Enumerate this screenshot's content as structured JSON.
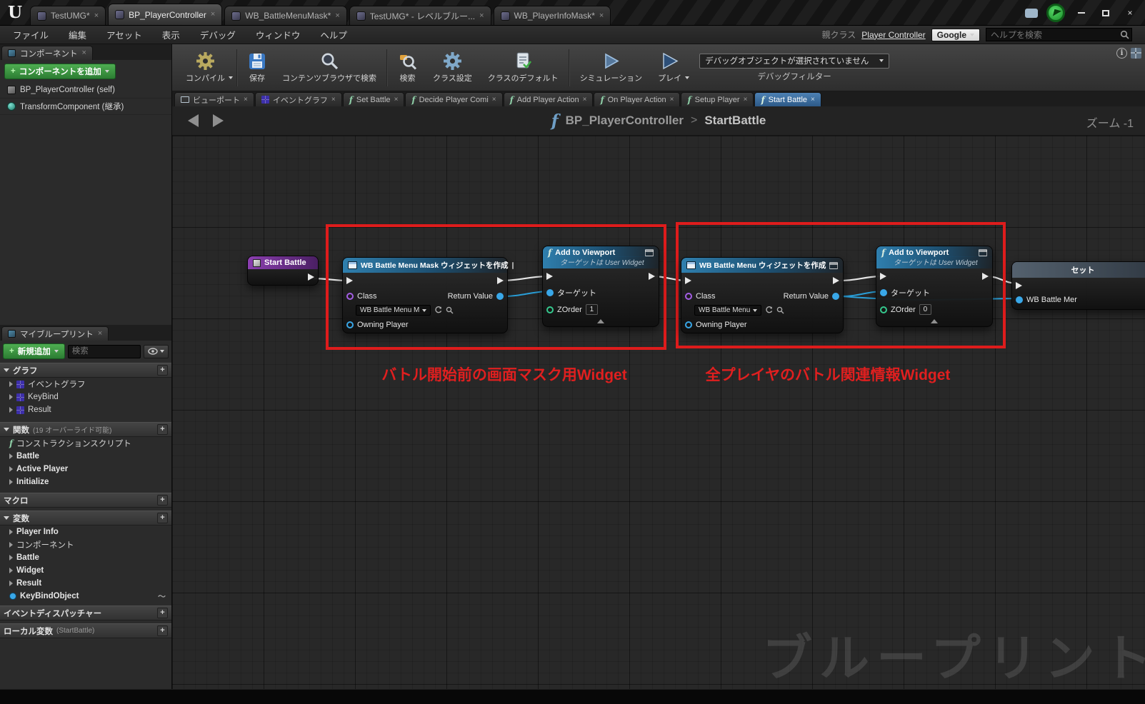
{
  "glyphs": {
    "f": "f",
    "close": "×",
    "gt": ">",
    "plus": "+"
  },
  "colors": {
    "annotation_red": "#de1c1c",
    "node_header_blue": "#2f7fae",
    "event_node_purple": "#8b3fb0",
    "accent_green": "#3fae46",
    "wire_blue": "#2a9fd8",
    "active_tab_blue": "#2d5a88"
  },
  "titlebar": {
    "tabs": [
      {
        "label": "TestUMG*"
      },
      {
        "label": "BP_PlayerController"
      },
      {
        "label": "WB_BattleMenuMask*"
      },
      {
        "label": "TestUMG* - レベルブルー..."
      },
      {
        "label": "WB_PlayerInfoMask*"
      }
    ]
  },
  "menubar": {
    "items": [
      "ファイル",
      "編集",
      "アセット",
      "表示",
      "デバッグ",
      "ウィンドウ",
      "ヘルプ"
    ],
    "parent_class_label": "親クラス",
    "parent_class_value": "Player Controller",
    "google_label": "Google",
    "help_search_placeholder": "ヘルプを検索"
  },
  "components_panel": {
    "tab_title": "コンポーネント",
    "add_component_button": "コンポーネントを追加",
    "tree": [
      {
        "label": "BP_PlayerController (self)"
      },
      {
        "label": "TransformComponent (継承)"
      }
    ]
  },
  "my_blueprint": {
    "tab_title": "マイブループリント",
    "add_new_button": "新規追加",
    "search_placeholder": "検索",
    "sections": {
      "graphs": {
        "title": "グラフ",
        "items": [
          "イベントグラフ",
          "KeyBind",
          "Result"
        ]
      },
      "functions": {
        "title": "関数",
        "subtitle": "(19 オーバーライド可能)",
        "items": [
          "コンストラクションスクリプト",
          "Battle",
          "Active Player",
          "Initialize"
        ]
      },
      "macros": {
        "title": "マクロ"
      },
      "variables": {
        "title": "変数",
        "items": [
          "Player Info",
          "コンポーネント",
          "Battle",
          "Widget",
          "Result",
          "KeyBindObject"
        ]
      },
      "dispatchers": {
        "title": "イベントディスパッチャー"
      },
      "locals": {
        "title": "ローカル変数",
        "subtitle": "(StartBattle)"
      }
    }
  },
  "toolbar": {
    "compile": "コンパイル",
    "save": "保存",
    "find_in_cb": "コンテンツブラウザで検索",
    "search": "検索",
    "class_settings": "クラス設定",
    "class_defaults": "クラスのデフォルト",
    "simulate": "シミュレーション",
    "play": "プレイ",
    "debug_object_dropdown": "デバッグオブジェクトが選択されていません",
    "debug_filter": "デバッグフィルター"
  },
  "graph_tabs": [
    {
      "label": "ビューポート"
    },
    {
      "label": "イベントグラフ"
    },
    {
      "label": "Set Battle"
    },
    {
      "label": "Decide Player Comi"
    },
    {
      "label": "Add Player Action"
    },
    {
      "label": "On Player Action"
    },
    {
      "label": "Setup Player"
    },
    {
      "label": "Start Battle"
    }
  ],
  "breadcrumb": {
    "owner": "BP_PlayerController",
    "current": "StartBattle",
    "zoom": "ズーム -1"
  },
  "graph": {
    "nodes": {
      "start_battle": {
        "title": "Start Battle"
      },
      "create_mask": {
        "title": "WB Battle Menu Mask ウィジェットを作成",
        "class_label": "Class",
        "class_value": "WB Battle Menu M",
        "owning_player_label": "Owning Player",
        "return_label": "Return Value"
      },
      "add_viewport_1": {
        "title": "Add to Viewport",
        "subtitle": "ターゲットは User Widget",
        "target_label": "ターゲット",
        "zorder_label": "ZOrder",
        "zorder_value": "1"
      },
      "create_menu": {
        "title": "WB Battle Menu ウィジェットを作成",
        "class_label": "Class",
        "class_value": "WB Battle Menu",
        "owning_player_label": "Owning Player",
        "return_label": "Return Value"
      },
      "add_viewport_2": {
        "title": "Add to Viewport",
        "subtitle": "ターゲットは User Widget",
        "target_label": "ターゲット",
        "zorder_label": "ZOrder",
        "zorder_value": "0"
      },
      "set_node": {
        "title": "セット",
        "pin_label": "WB Battle Mer"
      }
    },
    "annotations": [
      {
        "text": "バトル開始前の画面マスク用Widget"
      },
      {
        "text": "全プレイヤのバトル関連情報Widget"
      }
    ],
    "watermark": "ブループリント"
  }
}
